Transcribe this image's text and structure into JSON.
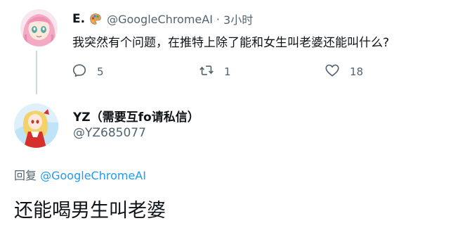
{
  "tweet": {
    "author_name": "E.",
    "author_handle": "@GoogleChromeAI",
    "separator": "·",
    "time": "3小时",
    "text": "我突然有个问题，在推特上除了能和女生叫老婆还能叫什么?",
    "actions": {
      "reply_count": "5",
      "retweet_count": "1",
      "like_count": "18"
    }
  },
  "reply": {
    "author_name": "YZ（需要互fo请私信）",
    "author_handle": "@YZ685077",
    "replying_prefix": "回复",
    "replying_to": "@GoogleChromeAI",
    "text": "还能喝男生叫老婆"
  },
  "icons": {
    "reply": "reply-icon",
    "retweet": "retweet-icon",
    "like": "heart-icon",
    "palette": "palette-emoji-icon"
  },
  "colors": {
    "text_primary": "#0f1419",
    "text_secondary": "#536471",
    "link": "#1d9bf0",
    "thread_line": "#cfd9de"
  }
}
